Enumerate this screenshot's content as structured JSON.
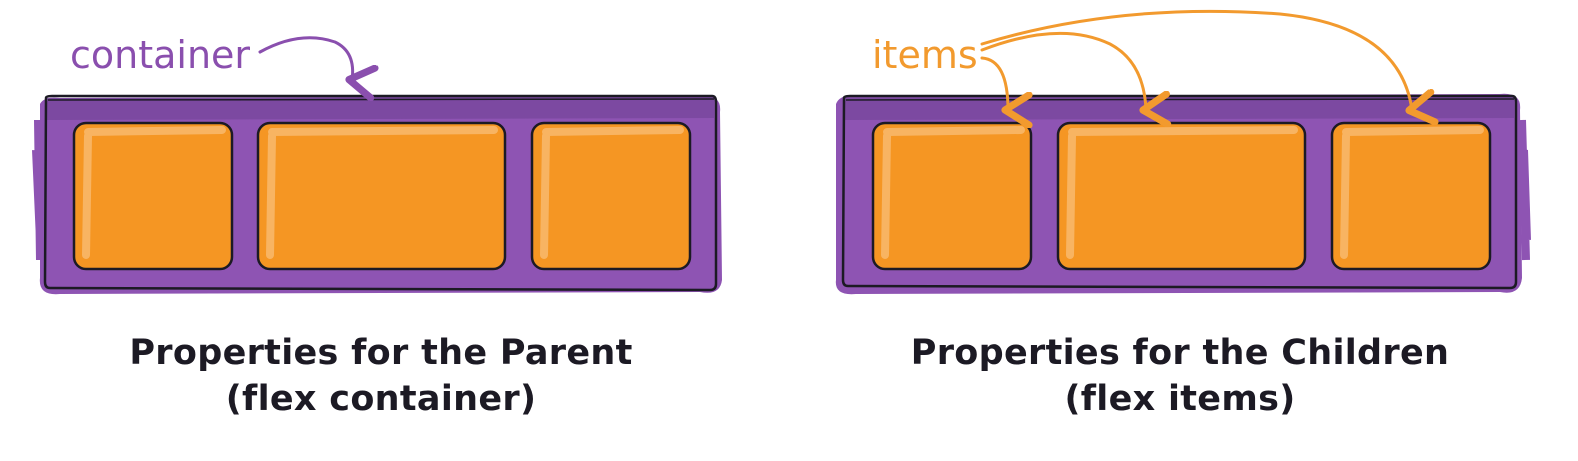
{
  "colors": {
    "container": "#8e54b3",
    "container_dark": "#6e3f92",
    "item": "#f59623",
    "item_highlight": "#f8b462",
    "outline": "#1c1a24",
    "container_label": "#8a4fae",
    "items_label": "#f29a2e"
  },
  "parent": {
    "annotation": "container",
    "title": "Properties for the Parent",
    "subtitle": "(flex container)",
    "item_count": 3
  },
  "children": {
    "annotation": "items",
    "title": "Properties for the Children",
    "subtitle": "(flex items)",
    "item_count": 3
  }
}
